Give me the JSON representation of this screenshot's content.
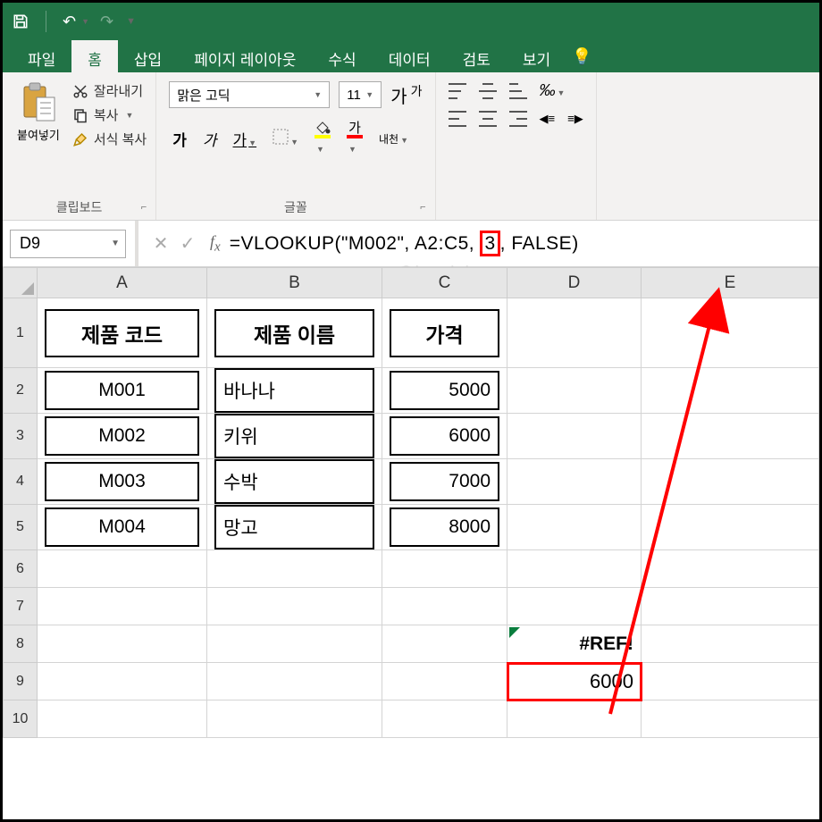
{
  "titlebar": {
    "undo_glyph": "↶",
    "redo_glyph": "↷"
  },
  "tabs": {
    "file": "파일",
    "home": "홈",
    "insert": "삽입",
    "layout": "페이지 레이아웃",
    "formulas": "수식",
    "data": "데이터",
    "review": "검토",
    "view": "보기"
  },
  "ribbon": {
    "clipboard": {
      "paste": "붙여넣기",
      "cut": "잘라내기",
      "copy": "복사",
      "format_painter": "서식 복사",
      "label": "클립보드"
    },
    "font": {
      "name": "맑은 고딕",
      "size": "11",
      "grow": "가",
      "shrink": "가",
      "bold": "가",
      "italic": "가",
      "underline": "가",
      "ruby": "내천",
      "label": "글꼴"
    },
    "align": {
      "wrap_glyph": "↩"
    }
  },
  "namebox": "D9",
  "formula": {
    "pre": "=VLOOKUP(\"M002\", A2:C5, ",
    "hl": "3",
    "post": ", FALSE)"
  },
  "watermark": "@jeaniel",
  "columns": [
    "A",
    "B",
    "C",
    "D",
    "E"
  ],
  "rows": [
    "1",
    "2",
    "3",
    "4",
    "5",
    "6",
    "7",
    "8",
    "9",
    "10"
  ],
  "table": {
    "headers": {
      "code": "제품 코드",
      "name": "제품 이름",
      "price": "가격"
    },
    "rows": [
      {
        "code": "M001",
        "name": "바나나",
        "price": "5000"
      },
      {
        "code": "M002",
        "name": "키위",
        "price": "6000"
      },
      {
        "code": "M003",
        "name": "수박",
        "price": "7000"
      },
      {
        "code": "M004",
        "name": "망고",
        "price": "8000"
      }
    ]
  },
  "d8": "#REF!",
  "d9": "6000"
}
